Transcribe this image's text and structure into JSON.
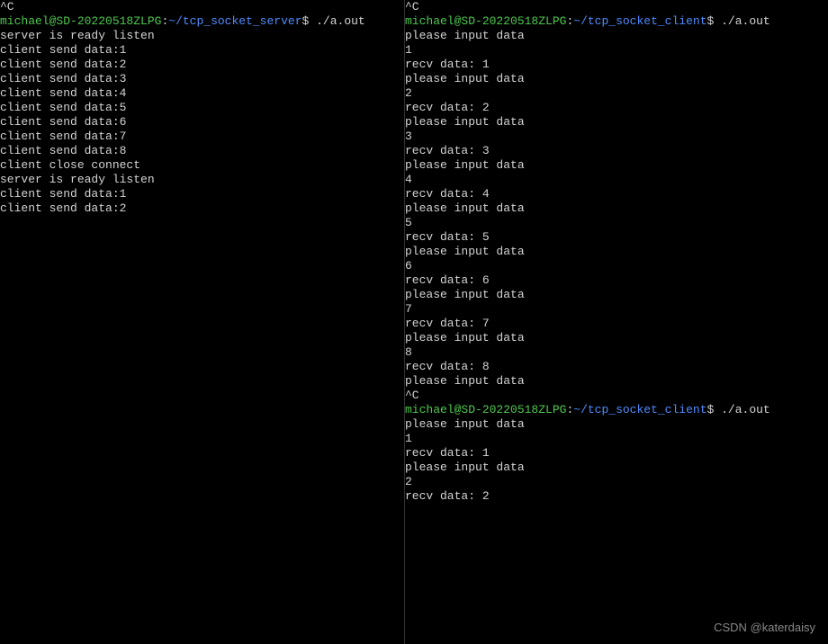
{
  "prompt": {
    "user": "michael",
    "at": "@",
    "host": "SD-20220518ZLPG",
    "colon": ":",
    "tilde": "~",
    "server_path": "/tcp_socket_server",
    "client_path": "/tcp_socket_client",
    "dollar": "$",
    "command": " ./a.out"
  },
  "ctrl_c": "^C",
  "server_ready": "server is ready listen",
  "client_send_prefix": "client send data:",
  "client_close": "client close connect",
  "please_input": "please input data",
  "recv_prefix": "recv data: ",
  "left": {
    "session1_sends": [
      "1",
      "2",
      "3",
      "4",
      "5",
      "6",
      "7",
      "8"
    ],
    "session2_sends": [
      "1",
      "2"
    ]
  },
  "right": {
    "session1_exchanges": [
      {
        "in": "1",
        "out": "1"
      },
      {
        "in": "2",
        "out": "2"
      },
      {
        "in": "3",
        "out": "3"
      },
      {
        "in": "4",
        "out": "4"
      },
      {
        "in": "5",
        "out": "5"
      },
      {
        "in": "6",
        "out": "6"
      },
      {
        "in": "7",
        "out": "7"
      },
      {
        "in": "8",
        "out": "8"
      }
    ],
    "session2_exchanges": [
      {
        "in": "1",
        "out": "1"
      },
      {
        "in": "2",
        "out": "2"
      }
    ]
  },
  "watermark": "CSDN @katerdaisy"
}
